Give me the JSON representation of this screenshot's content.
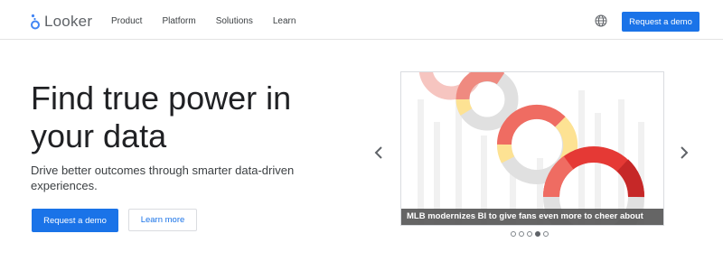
{
  "brand": {
    "name": "Looker"
  },
  "nav": {
    "links": [
      "Product",
      "Platform",
      "Solutions",
      "Learn"
    ],
    "globe_icon": "globe-icon",
    "cta_label": "Request a demo"
  },
  "hero": {
    "title": "Find true power in your data",
    "subtitle": "Drive better outcomes through smarter data-driven experiences.",
    "primary_cta": "Request a demo",
    "secondary_cta": "Learn more"
  },
  "carousel": {
    "caption": "MLB modernizes BI to give fans even more to cheer about",
    "slide_count": 5,
    "active_index": 3,
    "prev_icon": "chevron-left-icon",
    "next_icon": "chevron-right-icon"
  },
  "colors": {
    "primary": "#1a73e8",
    "text": "#202124",
    "ring_red": "#e53935",
    "ring_salmon": "#ef8a80",
    "ring_pink": "#f6c5c0",
    "ring_yellow": "#fde293",
    "ring_gray": "#e0e0e0"
  }
}
